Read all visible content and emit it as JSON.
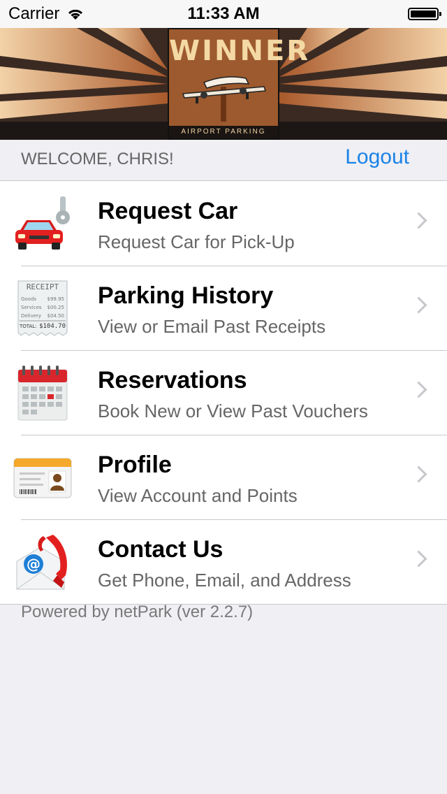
{
  "status_bar": {
    "carrier": "Carrier",
    "time": "11:33 AM"
  },
  "logo": {
    "title": "WINNER",
    "subtitle": "AIRPORT PARKING"
  },
  "welcome": {
    "text": "WELCOME, CHRIS!",
    "logout_label": "Logout"
  },
  "menu": {
    "items": [
      {
        "title": "Request Car",
        "subtitle": "Request Car for Pick-Up",
        "icon": "car-key-icon"
      },
      {
        "title": "Parking History",
        "subtitle": "View or Email Past Receipts",
        "icon": "receipt-icon"
      },
      {
        "title": "Reservations",
        "subtitle": "Book New or View Past Vouchers",
        "icon": "calendar-icon"
      },
      {
        "title": "Profile",
        "subtitle": "View Account and Points",
        "icon": "id-card-icon"
      },
      {
        "title": "Contact Us",
        "subtitle": "Get Phone, Email, and Address",
        "icon": "contact-icon"
      }
    ],
    "receipt_icon_text": {
      "header": "RECEIPT",
      "lines": [
        {
          "label": "Goods",
          "value": "$99.95"
        },
        {
          "label": "Services",
          "value": "$00.25"
        },
        {
          "label": "Delivery",
          "value": "$04.50"
        }
      ],
      "total_label": "TOTAL:",
      "total_value": "$104.70"
    }
  },
  "footer": {
    "text": "Powered by netPark (ver 2.2.7)"
  },
  "colors": {
    "accent": "#1a82e6",
    "background": "#efeff4",
    "logo_brown": "#9d5a2e"
  }
}
